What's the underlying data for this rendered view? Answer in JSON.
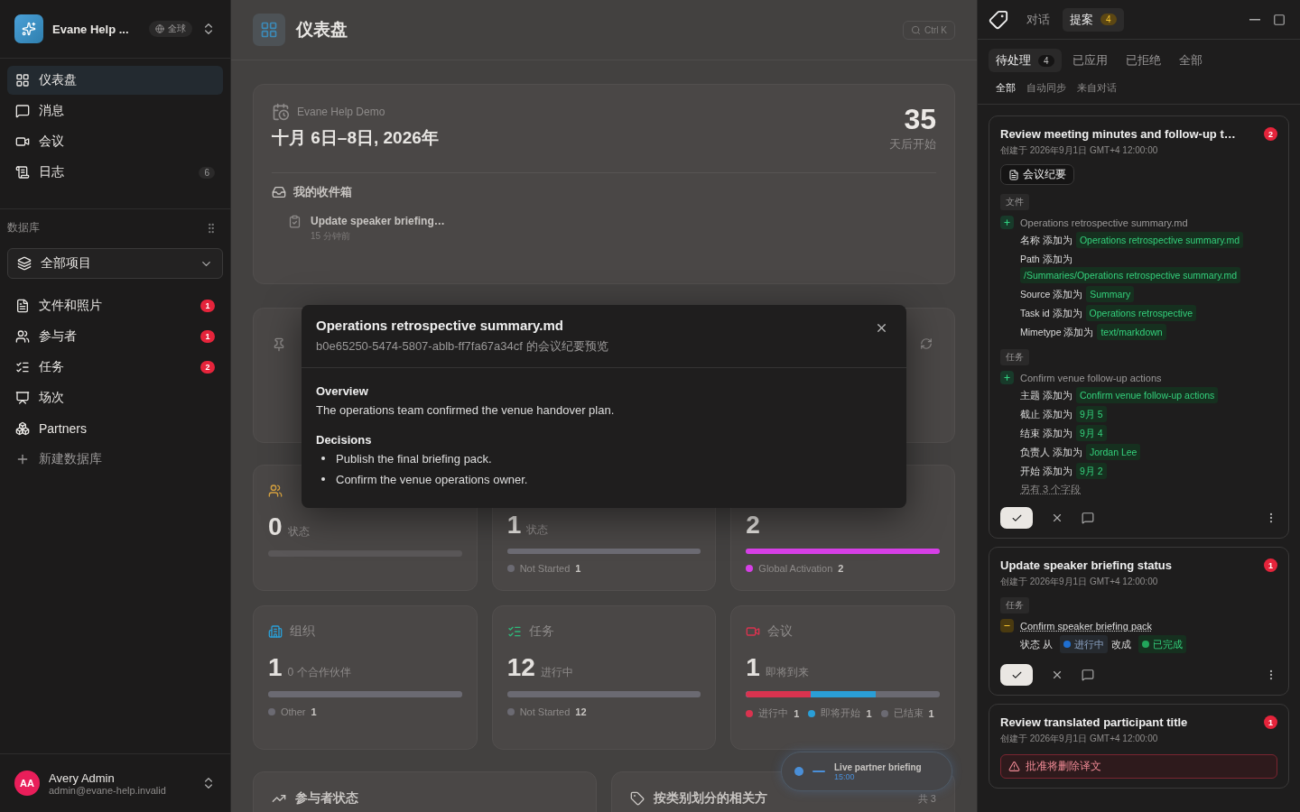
{
  "sidebar": {
    "workspace": {
      "name": "Evane Help ...",
      "scope": "全球"
    },
    "nav": [
      {
        "label": "仪表盘",
        "kind": "grid",
        "selected": true
      },
      {
        "label": "消息",
        "kind": "message",
        "selected": false
      },
      {
        "label": "会议",
        "kind": "video",
        "selected": false
      },
      {
        "label": "日志",
        "kind": "log",
        "selected": false,
        "count": "6"
      }
    ],
    "section_title": "数据库",
    "database_select": "全部项目",
    "databases": [
      {
        "label": "文件和照片",
        "kind": "file",
        "badge": "1"
      },
      {
        "label": "参与者",
        "kind": "users",
        "badge": "1"
      },
      {
        "label": "任务",
        "kind": "tasks",
        "badge": "2"
      },
      {
        "label": "场次",
        "kind": "session"
      },
      {
        "label": "Partners",
        "kind": "boxes"
      }
    ],
    "new_database": "新建数据库",
    "user": {
      "initials": "AA",
      "name": "Avery Admin",
      "email": "admin@evane-help.invalid"
    }
  },
  "main": {
    "title": "仪表盘",
    "search_shortcut": "Ctrl K",
    "event": {
      "name": "Evane Help Demo",
      "dates": "十月 6日–8日, 2026年",
      "countdown": "35",
      "countdown_label": "天后开始",
      "inbox_title": "我的收件箱",
      "inbox_items": [
        {
          "title": "Update speaker briefing…",
          "time": "15 分钟前"
        }
      ]
    },
    "stat_rows": [
      [
        {
          "kind": "participants",
          "value": "0",
          "label": "状态"
        },
        {
          "kind": "hidden",
          "value": "1",
          "label": "状态",
          "segments": [
            {
              "level": 1,
              "color": "#6b6a72"
            }
          ],
          "legend": [
            {
              "label": "Not Started",
              "count": "1",
              "color": "#6b6a72"
            }
          ]
        },
        {
          "kind": "hidden",
          "value": "2",
          "segments": [
            {
              "level": 1,
              "color": "#d63fe6"
            }
          ],
          "legend": [
            {
              "label": "Global Activation",
              "count": "2",
              "color": "#d63fe6"
            }
          ]
        }
      ],
      [
        {
          "kind": "organizations",
          "title": "组织",
          "value": "1",
          "label": "0 个合作伙伴",
          "segments": [
            {
              "level": 1,
              "color": "#6b6a72"
            }
          ],
          "legend": [
            {
              "label": "Other",
              "count": "1",
              "color": "#6b6a72"
            }
          ]
        },
        {
          "kind": "tasks",
          "title": "任务",
          "value": "12",
          "label": "进行中",
          "segments": [
            {
              "level": 1,
              "color": "#6b6a72"
            }
          ],
          "legend": [
            {
              "label": "Not Started",
              "count": "12",
              "color": "#6b6a72"
            }
          ]
        },
        {
          "kind": "meetings",
          "title": "会议",
          "value": "1",
          "label": "即将到来",
          "segments": [
            {
              "level": 0.333,
              "color": "#d9334f"
            },
            {
              "level": 0.667,
              "color": "#2a9ed6"
            },
            {
              "level": 1,
              "color": "#6b6a72"
            }
          ],
          "legend": [
            {
              "label": "进行中",
              "count": "1",
              "color": "#d9334f"
            },
            {
              "label": "即将开始",
              "count": "1",
              "color": "#2a9ed6"
            },
            {
              "label": "已结束",
              "count": "1",
              "color": "#6b6a72"
            }
          ]
        }
      ]
    ],
    "panels": [
      {
        "kind": "trend",
        "title": "参与者状态"
      },
      {
        "kind": "tag",
        "title": "按类别划分的相关方",
        "count": "共 3"
      }
    ],
    "toast": {
      "title": "Live partner briefing",
      "time": "15:00"
    }
  },
  "modal": {
    "title": "Operations retrospective summary.md",
    "subtitle": "b0e65250-5474-5807-ablb-ff7fa67a34cf 的会议纪要预览",
    "sections": [
      {
        "heading": "Overview",
        "paragraph": "The operations team confirmed the venue handover plan."
      },
      {
        "heading": "Decisions",
        "bullets": [
          "Publish the final briefing pack.",
          "Confirm the venue operations owner."
        ]
      }
    ]
  },
  "assistant": {
    "tabs": [
      {
        "label": "对话",
        "selected": false
      },
      {
        "label": "提案",
        "selected": true,
        "badge": "4"
      }
    ],
    "status_tabs": [
      {
        "label": "待处理",
        "selected": true,
        "count": "4"
      },
      {
        "label": "已应用",
        "selected": false
      },
      {
        "label": "已拒绝",
        "selected": false
      },
      {
        "label": "全部",
        "selected": false
      }
    ],
    "filters": [
      {
        "label": "全部",
        "selected": true
      },
      {
        "label": "自动同步",
        "selected": false
      },
      {
        "label": "来自对话",
        "selected": false
      }
    ],
    "proposals": [
      {
        "title": "Review meeting minutes and follow-up t…",
        "badge": "2",
        "created": "创建于 2026年9月1日 GMT+4 12:00:00",
        "source": "会议纪要",
        "groups": [
          {
            "tag": "文件",
            "entries": [
              {
                "kind": "add",
                "name": "Operations retrospective summary.md",
                "fields": [
                  {
                    "label": "名称",
                    "verb": "添加为",
                    "value": "Operations retrospective summary.md"
                  },
                  {
                    "label": "Path",
                    "verb": "添加为",
                    "value": "/Summaries/Operations retrospective summary.md"
                  },
                  {
                    "label": "Source",
                    "verb": "添加为",
                    "value": "Summary"
                  },
                  {
                    "label": "Task id",
                    "verb": "添加为",
                    "value": "Operations retrospective"
                  },
                  {
                    "label": "Mimetype",
                    "verb": "添加为",
                    "value": "text/markdown"
                  }
                ]
              }
            ]
          },
          {
            "tag": "任务",
            "entries": [
              {
                "kind": "add",
                "name": "Confirm venue follow-up actions",
                "fields": [
                  {
                    "label": "主题",
                    "verb": "添加为",
                    "value": "Confirm venue follow-up actions"
                  },
                  {
                    "label": "截止",
                    "verb": "添加为",
                    "value": "9月 5"
                  },
                  {
                    "label": "结束",
                    "verb": "添加为",
                    "value": "9月 4"
                  },
                  {
                    "label": "负责人",
                    "verb": "添加为",
                    "value": "Jordan Lee"
                  },
                  {
                    "label": "开始",
                    "verb": "添加为",
                    "value": "9月 2"
                  }
                ],
                "more": "另有 3 个字段"
              }
            ]
          }
        ]
      },
      {
        "title": "Update speaker briefing status",
        "badge": "1",
        "created": "创建于 2026年9月1日 GMT+4 12:00:00",
        "groups": [
          {
            "tag": "任务",
            "entries": [
              {
                "kind": "change",
                "name": "Confirm speaker briefing pack",
                "field": "状态",
                "from_word": "从",
                "from": {
                  "label": "进行中",
                  "color": "#1f6fd1"
                },
                "to_word": "改成",
                "to": {
                  "label": "已完成",
                  "color": "#22a55b"
                }
              }
            ]
          }
        ]
      },
      {
        "title": "Review translated participant title",
        "badge": "1",
        "created": "创建于 2026年9月1日 GMT+4 12:00:00",
        "warning": "批准将删除译文"
      }
    ]
  }
}
